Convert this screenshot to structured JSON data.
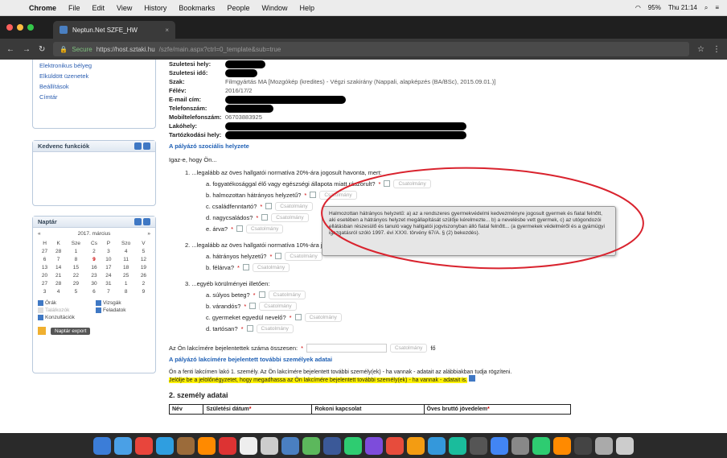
{
  "menubar": {
    "app": "Chrome",
    "items": [
      "File",
      "Edit",
      "View",
      "History",
      "Bookmarks",
      "People",
      "Window",
      "Help"
    ],
    "battery": "95%",
    "clock": "Thu 21:14"
  },
  "browser": {
    "tab_title": "Neptun.Net SZFE_HW",
    "secure_label": "Secure",
    "url_host": "https://host.sztaki.hu",
    "url_path": "/szfe/main.aspx?ctrl=0_template&sub=true"
  },
  "sidebar": {
    "links": [
      "Elektronikus bélyeg",
      "Elküldött üzenetek",
      "Beállítások",
      "Címtár"
    ],
    "favorites_title": "Kedvenc funkciók",
    "calendar_title": "Naptár",
    "calendar_month": "2017. március",
    "weekdays": [
      "H",
      "K",
      "Sze",
      "Cs",
      "P",
      "Szo",
      "V"
    ],
    "weeks": [
      [
        "27",
        "28",
        "1",
        "2",
        "3",
        "4",
        "5"
      ],
      [
        "6",
        "7",
        "8",
        "9",
        "10",
        "11",
        "12"
      ],
      [
        "13",
        "14",
        "15",
        "16",
        "17",
        "18",
        "19"
      ],
      [
        "20",
        "21",
        "22",
        "23",
        "24",
        "25",
        "26"
      ],
      [
        "27",
        "28",
        "29",
        "30",
        "31",
        "1",
        "2"
      ],
      [
        "3",
        "4",
        "5",
        "6",
        "7",
        "8",
        "9"
      ]
    ],
    "legend": [
      {
        "label": "Órák",
        "active": true
      },
      {
        "label": "Vizsgák",
        "active": true
      },
      {
        "label": "Találkozók",
        "active": false
      },
      {
        "label": "Feladatok",
        "active": true
      },
      {
        "label": "Konzultációk",
        "active": true
      }
    ],
    "export_label": "Naptár export"
  },
  "form": {
    "fields": [
      {
        "label": "Szuletesi hely:",
        "value": ""
      },
      {
        "label": "Szuletesi idő:",
        "value": ""
      },
      {
        "label": "Szak:",
        "value": "Filmgyártás MA [Mozgókép (kredites) - Végzi szakirány (Nappali, alapképzés (BA/BSc), 2015.09.01.)]"
      },
      {
        "label": "Félév:",
        "value": "2016/17/2"
      },
      {
        "label": "E-mail cím:",
        "value": ""
      },
      {
        "label": "Telefonszám:",
        "value": ""
      },
      {
        "label": "Mobiltelefonszám:",
        "value": "06703883925"
      },
      {
        "label": "Lakóhely:",
        "value": ""
      },
      {
        "label": "Tartózkodási hely:",
        "value": ""
      }
    ],
    "social_title": "A pályázó szociális helyzete",
    "intro": "Igaz-e, hogy Ön...",
    "q1": "1. ...legalább az öves hallgatói normatíva 20%-ára jogosult havonta, mert:",
    "q1_items": [
      "a. fogyatékosággal élő vagy egészségi állapota miatt rászorult?",
      "b. halmozottan hátrányos helyzetű?",
      "c. családfenntartó?",
      "d. nagycsaládos?",
      "e. árva?"
    ],
    "q2": "2. ...legalább az öves hallgatói normatíva 10%-ára jogosult havonta, mert:",
    "q2_items": [
      "a. hátrányos helyzetű?",
      "b. félárva?"
    ],
    "q3": "3. ...egyéb körülményei illetően:",
    "q3_items": [
      "a. súlyos beteg?",
      "b. várandós?",
      "c. gyermeket egyedül nevelő?",
      "d. tartósan?"
    ],
    "chip_label": "Csatolmány",
    "count_label": "Az Ön lakcímére bejelentettek száma összesen:",
    "count_unit": "fő",
    "residents_title": "A pályázó lakcímére bejelentett további személyek adatai",
    "residents_note": "Ön a fenti lakcímen lakó 1. személy. Az Ön lakcímére bejelentett további személy(ek) - ha vannak - adatait az alábbiakban tudja rögzíteni.",
    "residents_highlight": "Jelölje be a jelölőnégyzetet, hogy megadhassa az Ön lakcímére bejelentett további személy(ek) - ha vannak - adatait is.",
    "person2_title": "2. személy adatai",
    "table_headers": [
      "Név",
      "Születési dátum",
      "Rokoni kapcsolat",
      "Öves bruttó jövedelem"
    ]
  },
  "tooltip": {
    "text": "Halmozottan hátrányos helyzetű: a) az a rendszeres gyermekvédelmi kedvezményre jogosult gyermek és fiatal felnőtt, aki esetében a hátrányos helyzet megállapítását szülője kérelmezte... b) a nevelésbe vett gyermek, c) az utógondozói ellátásban részesülő és tanuló vagy hallgatói jogviszonyban álló fiatal felnőtt... (a gyermekek védelméről és a gyámügyi igazgatásról szóló 1997. évi XXXI. törvény 67/A. § (2) bekezdés)."
  },
  "colors": {
    "annotation": "#d9232e",
    "link": "#1e5fb4",
    "highlight": "#fff200"
  }
}
